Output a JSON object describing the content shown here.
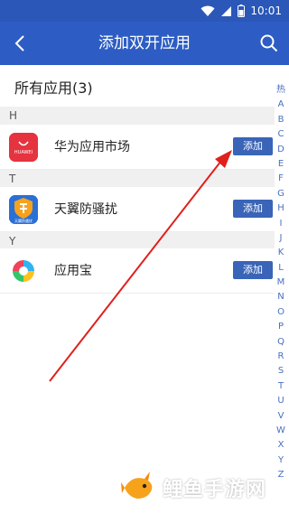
{
  "status_bar": {
    "time": "10:01",
    "icons": [
      "wifi-icon",
      "signal-icon",
      "battery-icon"
    ]
  },
  "app_bar": {
    "title": "添加双开应用",
    "back_icon": "chevron-left-icon",
    "search_icon": "search-icon"
  },
  "list_title": "所有应用(3)",
  "sections": [
    {
      "letter": "H",
      "apps": [
        {
          "name": "华为应用市场",
          "button": "添加",
          "icon": "huawei-appgallery-icon",
          "icon_text": "HUAWEI"
        }
      ]
    },
    {
      "letter": "T",
      "apps": [
        {
          "name": "天翼防骚扰",
          "button": "添加",
          "icon": "tianyi-anti-harassment-icon",
          "icon_text": "天翼防骚扰"
        }
      ]
    },
    {
      "letter": "Y",
      "apps": [
        {
          "name": "应用宝",
          "button": "添加",
          "icon": "yingyongbao-icon"
        }
      ]
    }
  ],
  "index_bar": [
    "热",
    "A",
    "B",
    "C",
    "D",
    "E",
    "F",
    "G",
    "H",
    "I",
    "J",
    "K",
    "L",
    "M",
    "N",
    "O",
    "P",
    "Q",
    "R",
    "S",
    "T",
    "U",
    "V",
    "W",
    "X",
    "Y",
    "Z"
  ],
  "watermark": {
    "text": "鲤鱼手游网",
    "icon": "carp-logo-icon"
  },
  "colors": {
    "primary": "#2d5dc4",
    "button": "#3a64b8",
    "arrow": "#e0201c",
    "index_text": "#4a6fbf"
  }
}
